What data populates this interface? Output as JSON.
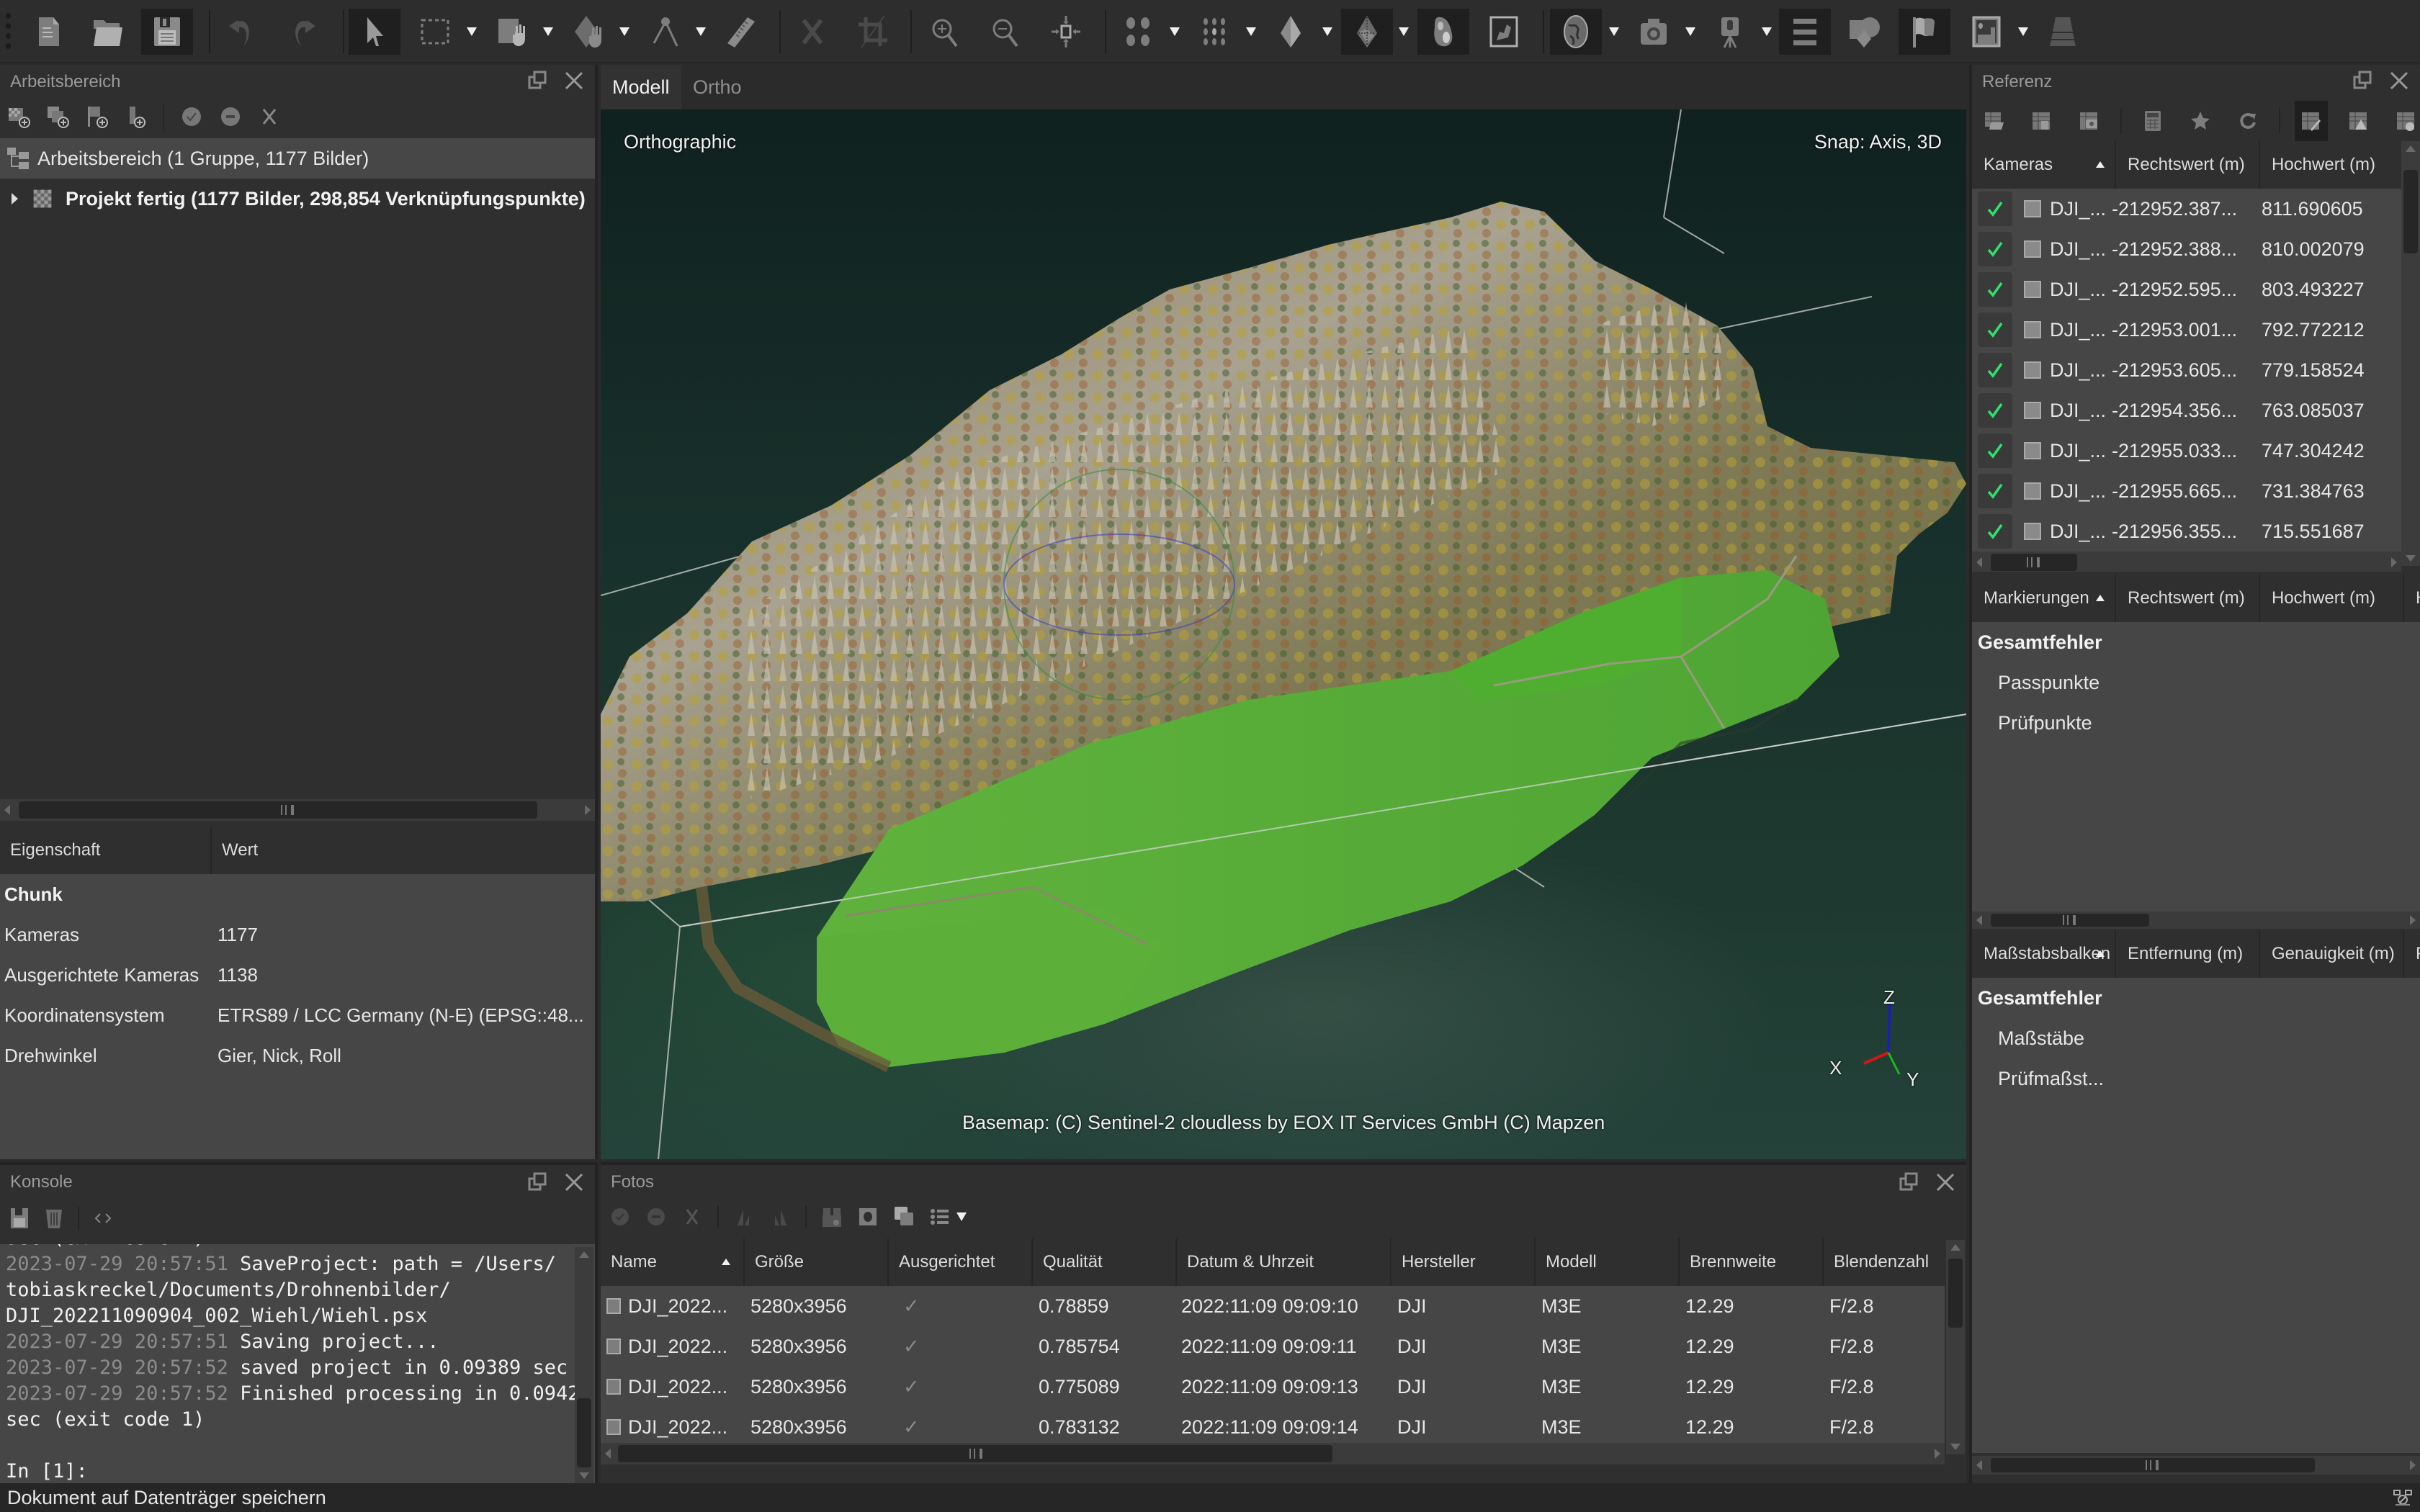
{
  "toolbar": {
    "items": [
      {
        "name": "new-document",
        "label": "Neu"
      },
      {
        "name": "open-folder",
        "label": "Öffnen"
      },
      {
        "name": "save",
        "label": "Speichern"
      },
      {
        "name": "undo",
        "label": "Rückgängig"
      },
      {
        "name": "redo",
        "label": "Wiederholen"
      },
      {
        "name": "navigation",
        "label": "Navigation"
      },
      {
        "name": "rectangle-selection",
        "label": "Rechteckauswahl"
      },
      {
        "name": "move-region",
        "label": "Region verschieben"
      },
      {
        "name": "rotate-object",
        "label": "Objekt drehen"
      },
      {
        "name": "measure-angle",
        "label": "Winkel messen"
      },
      {
        "name": "ruler",
        "label": "Lineal"
      },
      {
        "name": "delete-selection",
        "label": "Auswahl löschen"
      },
      {
        "name": "crop-selection",
        "label": "Auswahl zuschneiden"
      },
      {
        "name": "zoom-in",
        "label": "Vergrößern"
      },
      {
        "name": "zoom-out",
        "label": "Verkleinern"
      },
      {
        "name": "reset-view",
        "label": "Ansicht zurücksetzen"
      },
      {
        "name": "tie-points",
        "label": "Verknüpfungspunkte"
      },
      {
        "name": "dense-cloud",
        "label": "Dichte Punktwolke"
      },
      {
        "name": "model-shaded",
        "label": "Modell schattiert"
      },
      {
        "name": "model-textured",
        "label": "Modell texturiert"
      },
      {
        "name": "dem",
        "label": "DEM"
      },
      {
        "name": "orthomosaic",
        "label": "Orthomosaik"
      },
      {
        "name": "basemap",
        "label": "Basiskarte"
      },
      {
        "name": "show-cameras",
        "label": "Kameras anzeigen"
      },
      {
        "name": "show-trackers",
        "label": "Stative"
      },
      {
        "name": "show-shapes",
        "label": "Formen"
      },
      {
        "name": "show-regions",
        "label": "Regionen"
      },
      {
        "name": "show-markers",
        "label": "Markierungen"
      },
      {
        "name": "show-images",
        "label": "Bilder"
      },
      {
        "name": "layers",
        "label": "Ebenen"
      }
    ]
  },
  "workspace": {
    "title": "Arbeitsbereich",
    "tree": [
      {
        "label": "Arbeitsbereich (1 Gruppe, 1177 Bilder)"
      },
      {
        "label": "Projekt fertig (1177 Bilder, 298,854 Verknüpfungspunkte)"
      }
    ]
  },
  "properties": {
    "columns": [
      "Eigenschaft",
      "Wert"
    ],
    "group": "Chunk",
    "rows": [
      {
        "key": "Kameras",
        "value": "1177"
      },
      {
        "key": "Ausgerichtete Kameras",
        "value": "1138"
      },
      {
        "key": "Koordinatensystem",
        "value": "ETRS89 / LCC Germany (N-E) (EPSG::48..."
      },
      {
        "key": "Drehwinkel",
        "value": "Gier, Nick, Roll"
      }
    ]
  },
  "console": {
    "title": "Konsole",
    "cut_line": "sec (exit code 1)",
    "lines": [
      {
        "ts": "2023-07-29 20:57:51",
        "msg": "SaveProject: path = /Users/"
      },
      {
        "ts": "",
        "msg": "tobiaskreckel/Documents/Drohnenbilder/"
      },
      {
        "ts": "",
        "msg": "DJI_202211090904_002_Wiehl/Wiehl.psx"
      },
      {
        "ts": "2023-07-29 20:57:51",
        "msg": "Saving project..."
      },
      {
        "ts": "2023-07-29 20:57:52",
        "msg": "saved project in 0.09389 sec"
      },
      {
        "ts": "2023-07-29 20:57:52",
        "msg": "Finished processing in 0.0942"
      },
      {
        "ts": "",
        "msg": "sec (exit code 1)"
      },
      {
        "ts": "",
        "msg": ""
      },
      {
        "ts": "",
        "msg": "In [1]:"
      }
    ]
  },
  "viewport": {
    "tabs": [
      {
        "label": "Modell",
        "active": true
      },
      {
        "label": "Ortho",
        "active": false
      }
    ],
    "projection": "Orthographic",
    "snap": "Snap: Axis, 3D",
    "attribution": "Basemap: (C) Sentinel-2 cloudless by EOX IT Services GmbH (C) Mapzen",
    "axes": {
      "x": "X",
      "y": "Y",
      "z": "Z"
    },
    "axis_colors": {
      "x": "#d01818",
      "y": "#18b818",
      "z": "#1a1ad0"
    }
  },
  "photos": {
    "title": "Fotos",
    "columns": [
      "Name",
      "Größe",
      "Ausgerichtet",
      "Qualität",
      "Datum & Uhrzeit",
      "Hersteller",
      "Modell",
      "Brennweite",
      "Blendenzahl"
    ],
    "rows": [
      {
        "name": "DJI_2022...",
        "size": "5280x3956",
        "aligned": "✓",
        "quality": "0.78859",
        "datetime": "2022:11:09 09:09:10",
        "make": "DJI",
        "model": "M3E",
        "focal": "12.29",
        "fnumber": "F/2.8"
      },
      {
        "name": "DJI_2022...",
        "size": "5280x3956",
        "aligned": "✓",
        "quality": "0.785754",
        "datetime": "2022:11:09 09:09:11",
        "make": "DJI",
        "model": "M3E",
        "focal": "12.29",
        "fnumber": "F/2.8"
      },
      {
        "name": "DJI_2022...",
        "size": "5280x3956",
        "aligned": "✓",
        "quality": "0.775089",
        "datetime": "2022:11:09 09:09:13",
        "make": "DJI",
        "model": "M3E",
        "focal": "12.29",
        "fnumber": "F/2.8"
      },
      {
        "name": "DJI_2022...",
        "size": "5280x3956",
        "aligned": "✓",
        "quality": "0.783132",
        "datetime": "2022:11:09 09:09:14",
        "make": "DJI",
        "model": "M3E",
        "focal": "12.29",
        "fnumber": "F/2.8"
      }
    ]
  },
  "reference": {
    "title": "Referenz",
    "cameras": {
      "columns": [
        "Kameras",
        "Rechtswert (m)",
        "Hochwert (m)"
      ],
      "rows": [
        {
          "checked": true,
          "name": "DJI_...",
          "east": "-212952.387...",
          "north": "811.690605"
        },
        {
          "checked": true,
          "name": "DJI_...",
          "east": "-212952.388...",
          "north": "810.002079"
        },
        {
          "checked": true,
          "name": "DJI_...",
          "east": "-212952.595...",
          "north": "803.493227"
        },
        {
          "checked": true,
          "name": "DJI_...",
          "east": "-212953.001...",
          "north": "792.772212"
        },
        {
          "checked": true,
          "name": "DJI_...",
          "east": "-212953.605...",
          "north": "779.158524"
        },
        {
          "checked": true,
          "name": "DJI_...",
          "east": "-212954.356...",
          "north": "763.085037"
        },
        {
          "checked": true,
          "name": "DJI_...",
          "east": "-212955.033...",
          "north": "747.304242"
        },
        {
          "checked": true,
          "name": "DJI_...",
          "east": "-212955.665...",
          "north": "731.384763"
        },
        {
          "checked": true,
          "name": "DJI_...",
          "east": "-212956.355...",
          "north": "715.551687"
        }
      ]
    },
    "markers": {
      "columns": [
        "Markierungen",
        "Rechtswert (m)",
        "Hochwert (m)",
        "H"
      ],
      "total": "Gesamtfehler",
      "items": [
        "Passpunkte",
        "Prüfpunkte"
      ]
    },
    "scalebars": {
      "columns": [
        "Maßstabsbalken",
        "Entfernung (m)",
        "Genauigkeit (m)",
        "F"
      ],
      "total": "Gesamtfehler",
      "items": [
        "Maßstäbe",
        "Prüfmaßst..."
      ]
    },
    "check_color": "#2ee36b"
  },
  "statusbar": {
    "text": "Dokument auf Datenträger speichern"
  }
}
